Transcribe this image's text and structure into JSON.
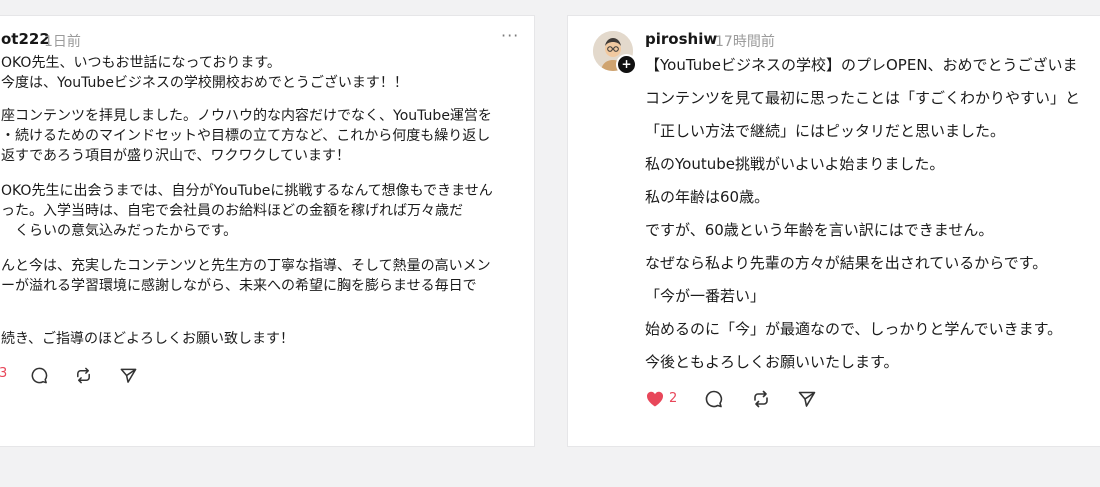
{
  "left_post": {
    "username": "ot222",
    "timestamp": "1日前",
    "paragraphs": [
      [
        "OKO先生、いつもお世話になっております。",
        "今度は、YouTubeビジネスの学校開校おめでとうございます！！"
      ],
      [
        "座コンテンツを拝見しました。ノウハウ的な内容だけでなく、YouTube運営を",
        "・続けるためのマインドセットや目標の立て方など、これから何度も繰り返し",
        "返すであろう項目が盛り沢山で、ワクワクしています！"
      ],
      [
        "OKO先生に出会うまでは、自分がYouTubeに挑戦するなんて想像もできません",
        "った。入学当時は、自宅で会社員のお給料ほどの金額を稼げれば万々歳だ",
        "　くらいの意気込みだったからです。"
      ],
      [
        "んと今は、充実したコンテンツと先生方の丁寧な指導、そして熱量の高いメン",
        "ーが溢れる学習環境に感謝しながら、未来への希望に胸を膨らませる毎日で"
      ],
      [
        "続き、ご指導のほどよろしくお願い致します！"
      ]
    ],
    "like_count": "3"
  },
  "right_post": {
    "username": "piroshiw",
    "timestamp": "17時間前",
    "lines": [
      "【YouTubeビジネスの学校】のプレOPEN、おめでとうございま",
      "コンテンツを見て最初に思ったことは「すごくわかりやすい」と",
      "「正しい方法で継続」にはピッタリだと思いました。",
      "私のYoutube挑戦がいよいよ始まりました。",
      "私の年齢は60歳。",
      "ですが、60歳という年齢を言い訳にはできません。",
      "なぜなら私より先輩の方々が結果を出されているからです。",
      "「今が一番若い」",
      "始めるのに「今」が最適なので、しっかりと学んでいきます。",
      "今後ともよろしくお願いいたします。"
    ],
    "like_count": "2",
    "avatar_badge": "+"
  },
  "icons": {
    "more": "more-icon",
    "heart": "heart-icon",
    "comment": "comment-icon",
    "repost": "repost-icon",
    "share": "send-icon"
  },
  "colors": {
    "like": "#e8475a",
    "muted": "#9b9b9b",
    "text": "#1b1b1b"
  }
}
